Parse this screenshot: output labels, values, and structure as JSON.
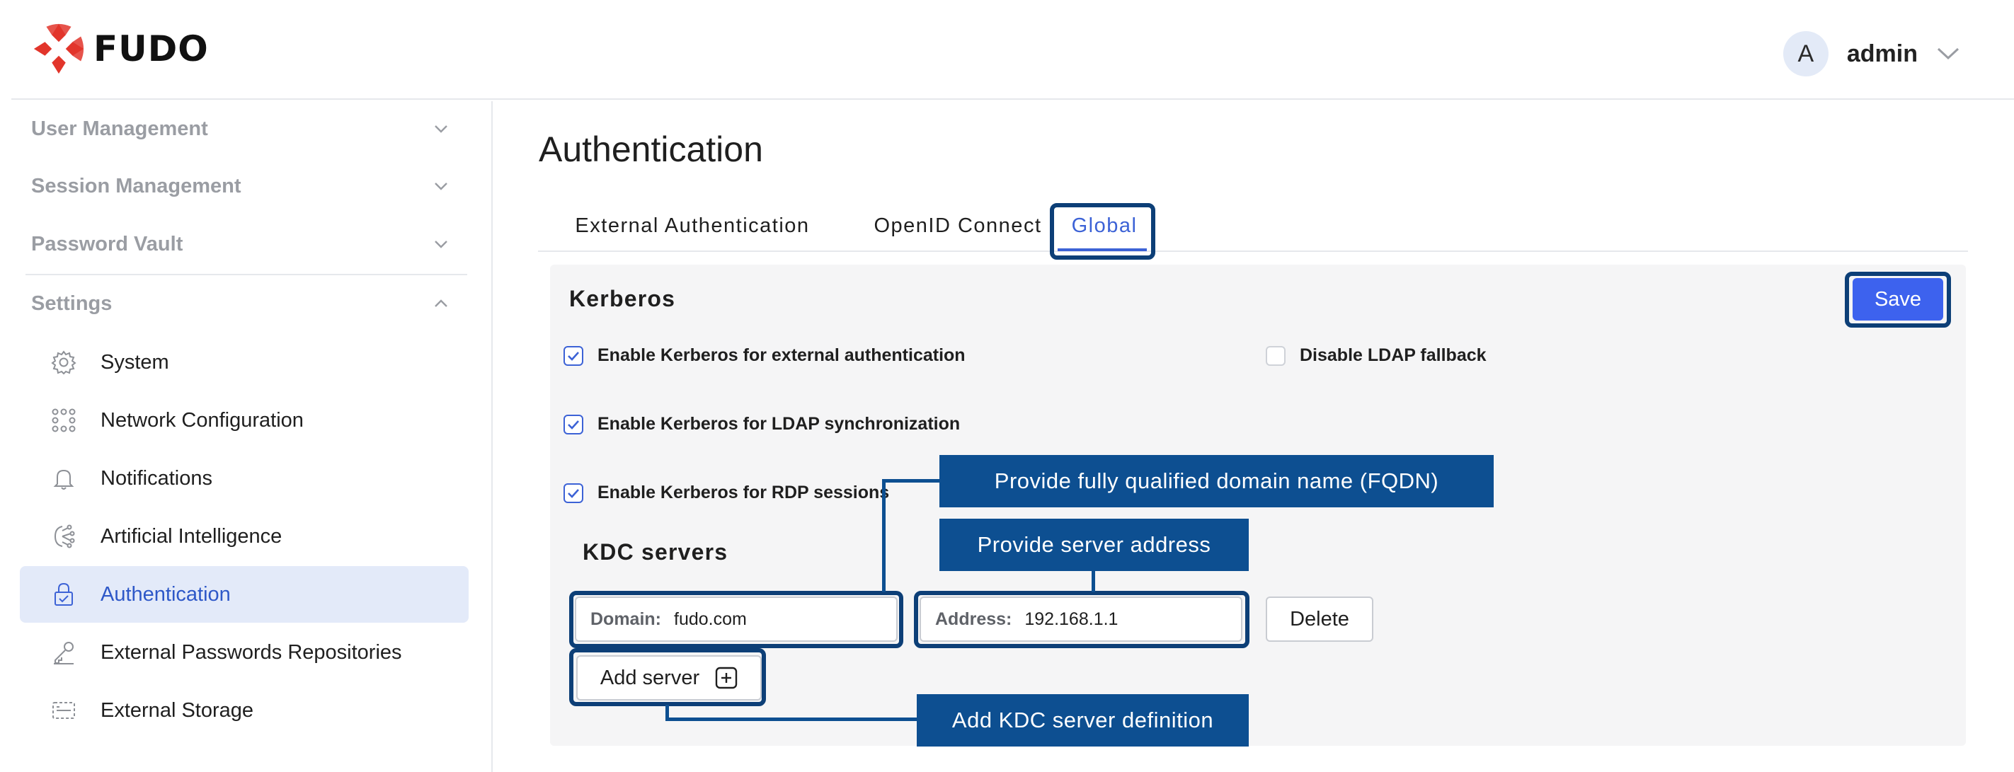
{
  "header": {
    "brand": "FUDO",
    "user": {
      "initial": "A",
      "name": "admin"
    }
  },
  "sidebar": {
    "groups": [
      {
        "label": "User Management"
      },
      {
        "label": "Session Management"
      },
      {
        "label": "Password Vault"
      },
      {
        "label": "Settings"
      }
    ],
    "items": [
      {
        "label": "System",
        "icon": "gear-icon"
      },
      {
        "label": "Network Configuration",
        "icon": "network-icon"
      },
      {
        "label": "Notifications",
        "icon": "bell-icon"
      },
      {
        "label": "Artificial Intelligence",
        "icon": "ai-icon"
      },
      {
        "label": "Authentication",
        "icon": "lock-icon",
        "active": true
      },
      {
        "label": "External Passwords Repositories",
        "icon": "key-icon"
      },
      {
        "label": "External Storage",
        "icon": "storage-icon"
      }
    ]
  },
  "main": {
    "title": "Authentication",
    "tabs": [
      {
        "label": "External Authentication"
      },
      {
        "label": "OpenID Connect"
      },
      {
        "label": "Global",
        "active": true
      }
    ],
    "kerberos": {
      "title": "Kerberos",
      "save_label": "Save",
      "options": [
        {
          "label": "Enable Kerberos for external authentication",
          "checked": true
        },
        {
          "label": "Disable LDAP fallback",
          "checked": false
        },
        {
          "label": "Enable Kerberos for LDAP synchronization",
          "checked": true
        },
        {
          "label": "Enable Kerberos for RDP sessions",
          "checked": true
        }
      ]
    },
    "kdc": {
      "title": "KDC servers",
      "domain_label": "Domain:",
      "domain_value": "fudo.com",
      "address_label": "Address:",
      "address_value": "192.168.1.1",
      "delete_label": "Delete",
      "add_label": "Add server"
    }
  },
  "annotations": {
    "fqdn": "Provide fully qualified domain name (FQDN)",
    "address": "Provide server address",
    "add": "Add KDC server definition"
  },
  "colors": {
    "accent": "#3c62d6",
    "save": "#3d62ee",
    "callout": "#0d4f91",
    "ring": "#0d3f77",
    "logo": "#e2352b"
  }
}
